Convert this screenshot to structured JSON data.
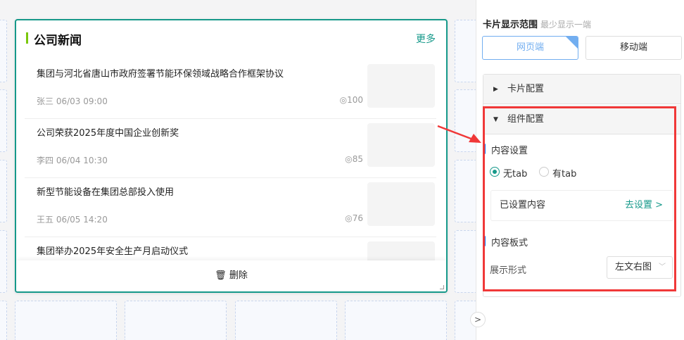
{
  "card": {
    "title": "公司新闻",
    "more": "更多",
    "delete": "删除",
    "items": [
      {
        "title": "集团与河北省唐山市政府签署节能环保领域战略合作框架协议",
        "author": "张三",
        "time": "06/03 09:00",
        "views": "100"
      },
      {
        "title": "公司荣获2025年度中国企业创新奖",
        "author": "李四",
        "time": "06/04 10:30",
        "views": "85"
      },
      {
        "title": "新型节能设备在集团总部投入使用",
        "author": "王五",
        "time": "06/05 14:20",
        "views": "76"
      },
      {
        "title": "集团举办2025年安全生产月启动仪式",
        "author": "",
        "time": "",
        "views": ""
      }
    ]
  },
  "panel": {
    "title": "卡片显示范围",
    "hint": "最少显示一端",
    "web": "网页端",
    "mobile": "移动端",
    "card_config": "卡片配置",
    "component_config": "组件配置",
    "content_settings": "内容设置",
    "radio_no_tab": "无tab",
    "radio_tab": "有tab",
    "content_set": "已设置内容",
    "go_set": "去设置 >",
    "content_layout": "内容板式",
    "display_label": "展示形式",
    "display_value": "左文右图"
  }
}
